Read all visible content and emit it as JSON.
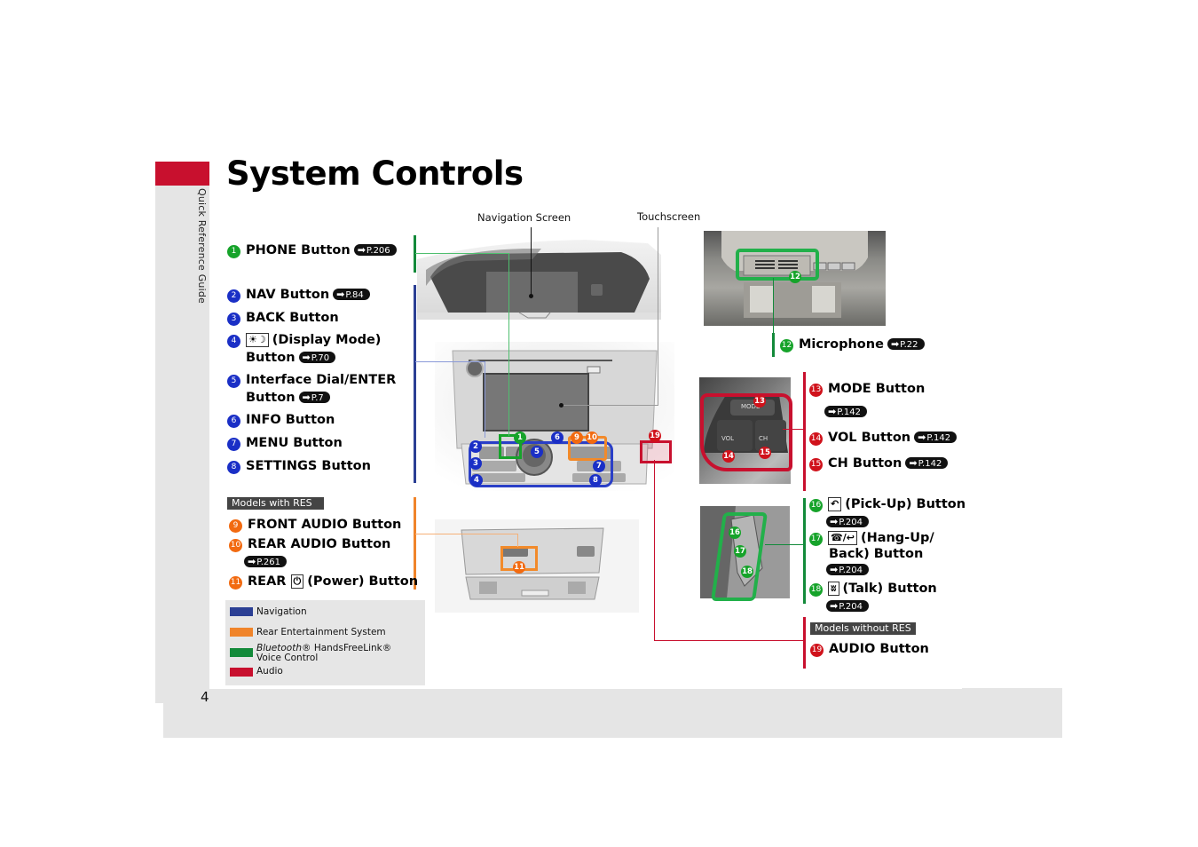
{
  "sidebar": {
    "section_label": "Quick Reference Guide"
  },
  "page": {
    "title": "System Controls",
    "page_number": "4"
  },
  "captions": {
    "navigation_screen": "Navigation Screen",
    "touchscreen": "Touchscreen"
  },
  "colors": {
    "navigation": "#2b3f94",
    "rear_entertainment": "#f0842a",
    "bluetooth": "#138a3a",
    "audio": "#c8102e",
    "section_tab": "#c8102e"
  },
  "left_items": [
    {
      "num": "1",
      "label": "PHONE Button",
      "ref": "P.206",
      "color": "green"
    },
    {
      "num": "2",
      "label": "NAV Button",
      "ref": "P.84",
      "color": "blue"
    },
    {
      "num": "3",
      "label": "BACK Button",
      "color": "blue"
    },
    {
      "num": "4",
      "icon": "☀☽",
      "label": "(Display Mode)",
      "label2": "Button",
      "ref": "P.70",
      "color": "blue"
    },
    {
      "num": "5",
      "label": "Interface Dial/ENTER",
      "label2": "Button",
      "ref": "P.7",
      "color": "blue"
    },
    {
      "num": "6",
      "label": "INFO Button",
      "color": "blue"
    },
    {
      "num": "7",
      "label": "MENU Button",
      "color": "blue"
    },
    {
      "num": "8",
      "label": "SETTINGS Button",
      "color": "blue"
    }
  ],
  "res_section": {
    "tag": "Models with RES",
    "items": [
      {
        "num": "9",
        "label": "FRONT AUDIO Button",
        "color": "orange"
      },
      {
        "num": "10",
        "label": "REAR AUDIO Button",
        "ref": "P.261",
        "color": "orange"
      },
      {
        "num": "11",
        "label_prefix": "REAR",
        "icon": "⏻",
        "label": "(Power) Button",
        "color": "orange"
      }
    ]
  },
  "right_items": {
    "microphone": {
      "num": "12",
      "label": "Microphone",
      "ref": "P.22"
    },
    "steering_audio": [
      {
        "num": "13",
        "label": "MODE Button",
        "ref": "P.142"
      },
      {
        "num": "14",
        "label": "VOL Button",
        "ref": "P.142"
      },
      {
        "num": "15",
        "label": "CH Button",
        "ref": "P.142"
      }
    ],
    "steering_phone": [
      {
        "num": "16",
        "icon": "↶",
        "label": "(Pick-Up) Button",
        "ref": "P.204"
      },
      {
        "num": "17",
        "icon": "☎/↩",
        "label": "(Hang-Up/",
        "label2": "Back) Button",
        "ref": "P.204"
      },
      {
        "num": "18",
        "icon": "ʬ",
        "label": "(Talk) Button",
        "ref": "P.204"
      }
    ],
    "no_res": {
      "tag": "Models without RES",
      "num": "19",
      "label": "AUDIO Button"
    }
  },
  "photo_labels": {
    "mode": "MODE",
    "vol": "VOL",
    "ch": "CH"
  },
  "legend": [
    {
      "label": "Navigation",
      "color": "#2b3f94"
    },
    {
      "label": "Rear Entertainment System",
      "color": "#f0842a"
    },
    {
      "label_italic": "Bluetooth",
      "label": "® HandsFreeLink®",
      "label2": "Voice Control",
      "color": "#138a3a"
    },
    {
      "label": "Audio",
      "color": "#c8102e"
    }
  ],
  "ref_arrow_icon": "arrow-right"
}
